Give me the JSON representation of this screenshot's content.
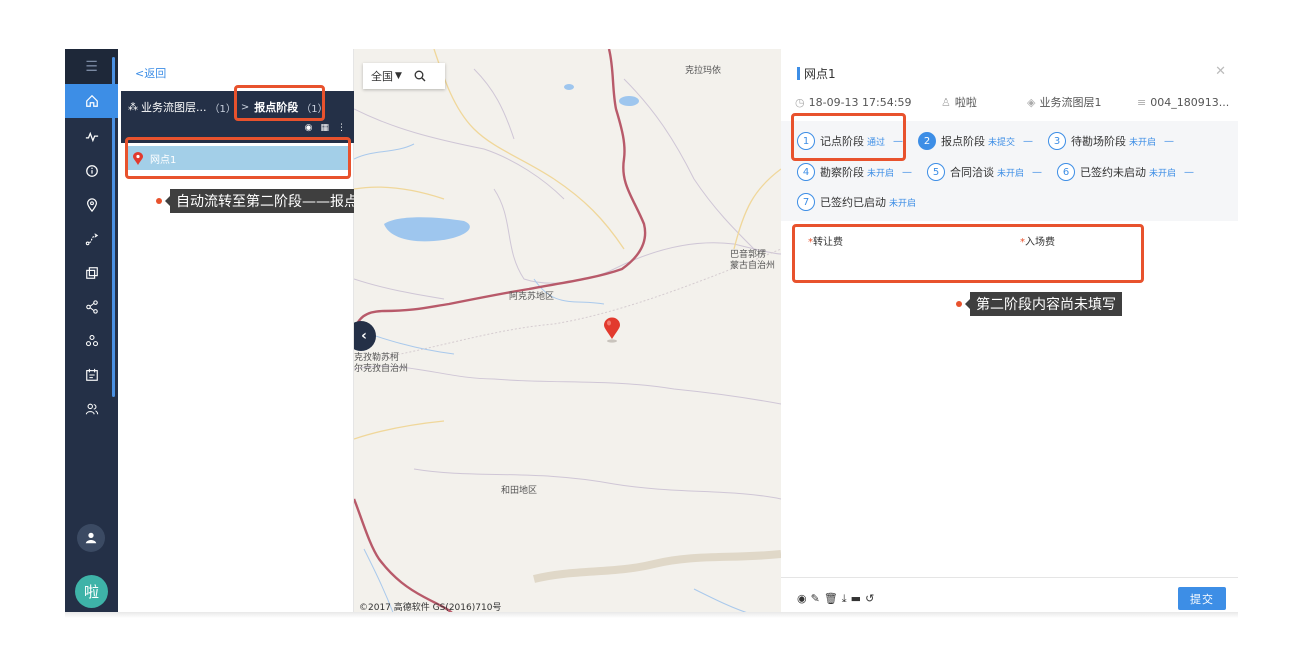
{
  "sidebar": {
    "menu_icon": "menu-icon",
    "items": [
      {
        "icon": "home-icon",
        "active": true
      },
      {
        "icon": "pulse-icon"
      },
      {
        "icon": "info-icon"
      },
      {
        "icon": "location-icon"
      },
      {
        "icon": "route-icon"
      },
      {
        "icon": "copy-icon"
      },
      {
        "icon": "share-icon"
      },
      {
        "icon": "cluster-icon"
      },
      {
        "icon": "calendar-icon"
      },
      {
        "icon": "users-icon"
      }
    ],
    "avatar_text": "啦"
  },
  "left_panel": {
    "back_label": "<返回",
    "breadcrumb": {
      "layer": "业务流图层...",
      "layer_count": "（1）",
      "separator": ">",
      "stage": "报点阶段",
      "stage_count": "（1）"
    },
    "list_items": [
      {
        "label": "网点1"
      }
    ],
    "callout": "自动流转至第二阶段——报点阶段"
  },
  "map": {
    "region_select": "全国",
    "labels": {
      "kizilsu_top": "克拉玛依",
      "bayingol": "巴音郭楞\n蒙古自治州",
      "aksu": "阿克苏地区",
      "kizilsu": "克孜勒苏柯\n尔克孜自治州",
      "hotan": "和田地区"
    },
    "copyright": "©2017 高德软件 GS(2016)710号"
  },
  "detail": {
    "title": "网点1",
    "meta": {
      "time": "18-09-13 17:54:59",
      "user": "啦啦",
      "layer": "业务流图层1",
      "code": "004_180913..."
    },
    "stages": [
      {
        "num": "1",
        "name": "记点阶段",
        "status": "通过"
      },
      {
        "num": "2",
        "name": "报点阶段",
        "status": "未提交",
        "current": true
      },
      {
        "num": "3",
        "name": "待勘场阶段",
        "status": "未开启"
      },
      {
        "num": "4",
        "name": "勘察阶段",
        "status": "未开启"
      },
      {
        "num": "5",
        "name": "合同洽谈",
        "status": "未开启"
      },
      {
        "num": "6",
        "name": "已签约未启动",
        "status": "未开启"
      },
      {
        "num": "7",
        "name": "已签约已启动",
        "status": "未开启"
      }
    ],
    "fields": [
      {
        "label": "转让费"
      },
      {
        "label": "入场费"
      }
    ],
    "callout": "第二阶段内容尚未填写",
    "submit_label": "提交"
  }
}
